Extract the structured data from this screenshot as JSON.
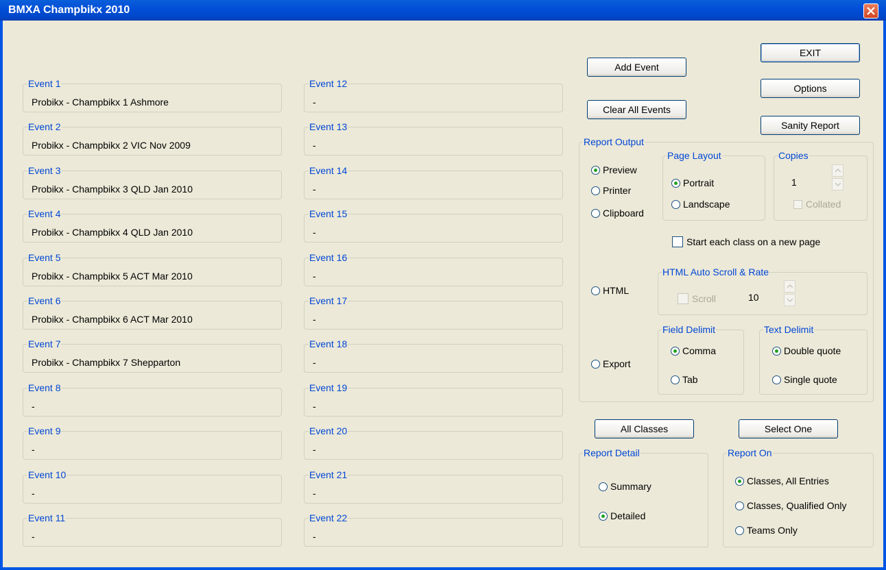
{
  "window": {
    "title": "BMXA Champbikx 2010"
  },
  "events_left": [
    {
      "label": "Event 1",
      "value": "Probikx - Champbikx 1 Ashmore"
    },
    {
      "label": "Event 2",
      "value": "Probikx - Champbikx 2 VIC Nov 2009"
    },
    {
      "label": "Event 3",
      "value": "Probikx - Champbikx 3 QLD Jan 2010"
    },
    {
      "label": "Event 4",
      "value": "Probikx - Champbikx 4 QLD Jan 2010"
    },
    {
      "label": "Event 5",
      "value": "Probikx - Champbikx 5 ACT Mar 2010"
    },
    {
      "label": "Event 6",
      "value": "Probikx - Champbikx 6 ACT Mar 2010"
    },
    {
      "label": "Event 7",
      "value": "Probikx - Champbikx 7 Shepparton"
    },
    {
      "label": "Event 8",
      "value": "-"
    },
    {
      "label": "Event 9",
      "value": "-"
    },
    {
      "label": "Event 10",
      "value": "-"
    },
    {
      "label": "Event 11",
      "value": "-"
    }
  ],
  "events_right": [
    {
      "label": "Event 12",
      "value": "-"
    },
    {
      "label": "Event 13",
      "value": "-"
    },
    {
      "label": "Event 14",
      "value": "-"
    },
    {
      "label": "Event 15",
      "value": "-"
    },
    {
      "label": "Event 16",
      "value": "-"
    },
    {
      "label": "Event 17",
      "value": "-"
    },
    {
      "label": "Event 18",
      "value": "-"
    },
    {
      "label": "Event 19",
      "value": "-"
    },
    {
      "label": "Event 20",
      "value": "-"
    },
    {
      "label": "Event 21",
      "value": "-"
    },
    {
      "label": "Event 22",
      "value": "-"
    }
  ],
  "buttons": {
    "exit": "EXIT",
    "add_event": "Add Event",
    "options": "Options",
    "clear_all": "Clear All Events",
    "sanity_report": "Sanity Report",
    "all_classes": "All Classes",
    "select_one": "Select One"
  },
  "report_output": {
    "label": "Report Output",
    "preview": "Preview",
    "printer": "Printer",
    "clipboard": "Clipboard",
    "html": "HTML",
    "export": "Export",
    "selected": "Preview"
  },
  "page_layout": {
    "label": "Page Layout",
    "portrait": "Portrait",
    "landscape": "Landscape",
    "selected": "Portrait"
  },
  "copies": {
    "label": "Copies",
    "value": "1",
    "collated": "Collated"
  },
  "new_page": {
    "label": "Start each class on a new page",
    "checked": false
  },
  "html_scroll": {
    "label": "HTML Auto Scroll & Rate",
    "scroll": "Scroll",
    "rate": "10"
  },
  "field_delimit": {
    "label": "Field Delimit",
    "comma": "Comma",
    "tab": "Tab",
    "selected": "Comma"
  },
  "text_delimit": {
    "label": "Text Delimit",
    "double": "Double quote",
    "single": "Single quote",
    "selected": "Double quote"
  },
  "report_detail": {
    "label": "Report Detail",
    "summary": "Summary",
    "detailed": "Detailed",
    "selected": "Detailed"
  },
  "report_on": {
    "label": "Report On",
    "all_entries": "Classes, All Entries",
    "qualified": "Classes, Qualified Only",
    "teams": "Teams Only",
    "selected": "Classes, All Entries"
  },
  "colors": {
    "titlebar": "#0054E3",
    "group_label": "#0046D5",
    "background": "#ECE9D8",
    "radio_dot": "#21A121"
  }
}
